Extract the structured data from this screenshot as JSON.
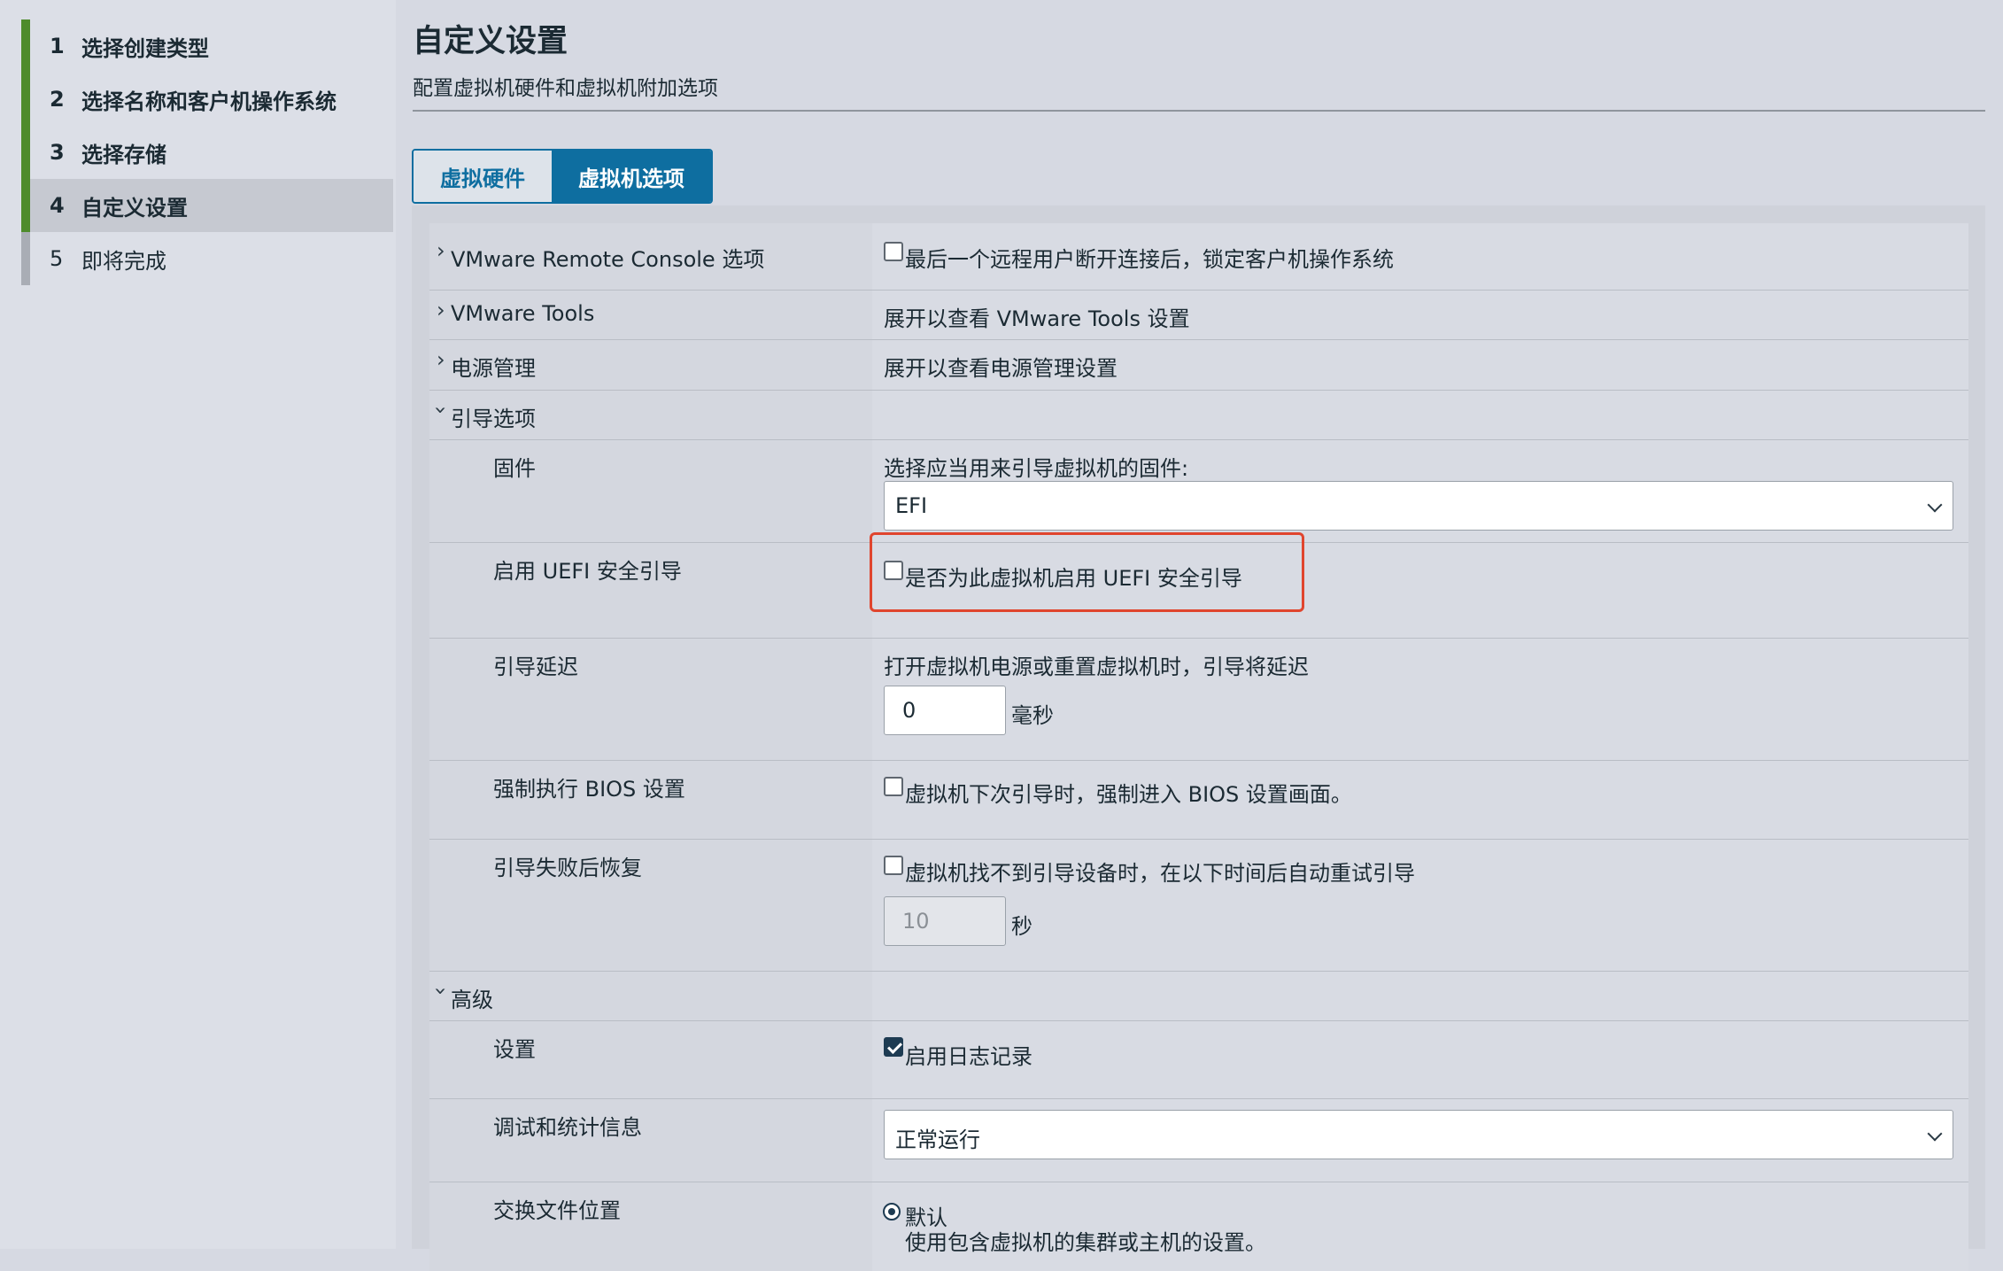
{
  "wizard": {
    "steps": [
      {
        "num": "1",
        "label": "选择创建类型"
      },
      {
        "num": "2",
        "label": "选择名称和客户机操作系统"
      },
      {
        "num": "3",
        "label": "选择存储"
      },
      {
        "num": "4",
        "label": "自定义设置"
      },
      {
        "num": "5",
        "label": "即将完成"
      }
    ]
  },
  "header": {
    "title": "自定义设置",
    "subtitle": "配置虚拟机硬件和虚拟机附加选项"
  },
  "tabs": [
    {
      "label": "虚拟硬件",
      "selected": false
    },
    {
      "label": "虚拟机选项",
      "selected": true
    }
  ],
  "options": {
    "remote_console": {
      "label": "VMware Remote Console 选项",
      "checkbox_label": "最后一个远程用户断开连接后，锁定客户机操作系统",
      "checked": false
    },
    "vmware_tools": {
      "label": "VMware Tools",
      "value": "展开以查看 VMware Tools 设置"
    },
    "power": {
      "label": "电源管理",
      "value": "展开以查看电源管理设置"
    },
    "boot": {
      "label": "引导选项",
      "firmware": {
        "label": "固件",
        "hint": "选择应当用来引导虚拟机的固件:",
        "selected": "EFI"
      },
      "secure_boot": {
        "label": "启用 UEFI 安全引导",
        "checkbox_label": "是否为此虚拟机启用 UEFI 安全引导",
        "checked": false
      },
      "boot_delay": {
        "label": "引导延迟",
        "hint": "打开虚拟机电源或重置虚拟机时，引导将延迟",
        "value": "0",
        "unit": "毫秒"
      },
      "force_bios": {
        "label": "强制执行 BIOS 设置",
        "checkbox_label": "虚拟机下次引导时，强制进入 BIOS 设置画面。",
        "checked": false
      },
      "failed_recovery": {
        "label": "引导失败后恢复",
        "checkbox_label": "虚拟机找不到引导设备时，在以下时间后自动重试引导",
        "checked": false,
        "value": "10",
        "unit": "秒"
      }
    },
    "advanced": {
      "label": "高级",
      "settings": {
        "label": "设置",
        "checkbox_label": "启用日志记录",
        "checked": true
      },
      "debug": {
        "label": "调试和统计信息",
        "selected": "正常运行"
      },
      "swap": {
        "label": "交换文件位置",
        "radio_label": "默认",
        "radio_desc": "使用包含虚拟机的集群或主机的设置。"
      }
    }
  },
  "colors": {
    "accent": "#0e6ea0",
    "step_done": "#4e8b2c",
    "highlight": "#e0452e"
  }
}
